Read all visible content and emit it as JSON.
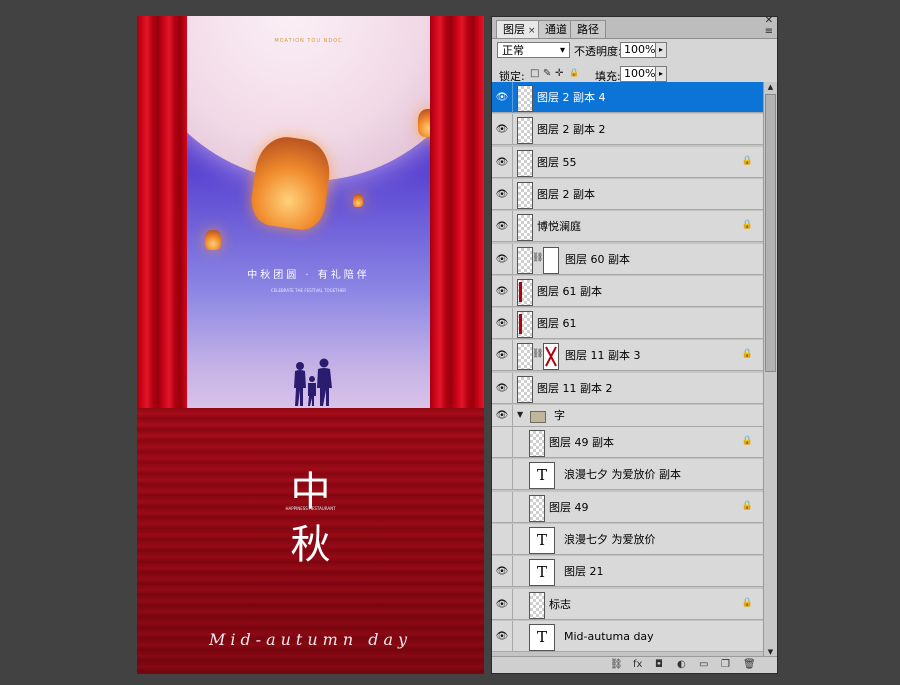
{
  "poster": {
    "brand_top": "MOATION TOU NDOC",
    "slogan": "中秋团圆 · 有礼陪伴",
    "subslogan": "CELEBRATE THE FESTIVAL TOGETHER",
    "char_one": "中",
    "char_two": "秋",
    "small_brand": "HAPPINESS RESTAURANT",
    "script": "Mid-autumn day"
  },
  "panel": {
    "tabs": [
      "图层",
      "通道",
      "路径"
    ],
    "tab_close": "×",
    "close_glyph": "✕",
    "menu_glyph": "≡",
    "blend_mode": "正常",
    "opacity_label": "不透明度:",
    "opacity_value": "100%",
    "lock_label": "锁定:",
    "fill_label": "填充:",
    "fill_value": "100%",
    "lock_icons": [
      "□",
      "✎",
      "✛",
      "🔒"
    ],
    "layers": [
      {
        "name": "图层 2 副本 4",
        "visible": true,
        "thumb": "checker",
        "locked": false,
        "selected": true
      },
      {
        "name": "图层 2 副本 2",
        "visible": true,
        "thumb": "checker",
        "locked": false
      },
      {
        "name": "图层 55",
        "visible": true,
        "thumb": "checker",
        "locked": true
      },
      {
        "name": "图层 2 副本",
        "visible": true,
        "thumb": "checker",
        "locked": false
      },
      {
        "name": "博悦澜庭",
        "visible": true,
        "thumb": "checker",
        "locked": true
      },
      {
        "name": "图层 60 副本",
        "visible": true,
        "thumb": "checker-mask",
        "locked": false
      },
      {
        "name": "图层 61 副本",
        "visible": true,
        "thumb": "red",
        "locked": false
      },
      {
        "name": "图层 61",
        "visible": true,
        "thumb": "red",
        "locked": false
      },
      {
        "name": "图层 11 副本 3",
        "visible": true,
        "thumb": "checker-mask-x",
        "locked": true
      },
      {
        "name": "图层 11 副本 2",
        "visible": true,
        "thumb": "checker",
        "locked": false
      },
      {
        "name": "字",
        "visible": true,
        "thumb": "group",
        "locked": false
      },
      {
        "name": "图层 49 副本",
        "visible": false,
        "thumb": "checker",
        "locked": true
      },
      {
        "name": "浪漫七夕 为爱放价 副本",
        "visible": false,
        "thumb": "type",
        "locked": false
      },
      {
        "name": "图层 49",
        "visible": false,
        "thumb": "checker",
        "locked": true
      },
      {
        "name": "浪漫七夕 为爱放价",
        "visible": false,
        "thumb": "type",
        "locked": false
      },
      {
        "name": "图层 21",
        "visible": true,
        "thumb": "type",
        "locked": false
      },
      {
        "name": "标志",
        "visible": true,
        "thumb": "checker",
        "locked": true
      },
      {
        "name": "Mid-autuma day",
        "visible": true,
        "thumb": "type",
        "locked": false
      }
    ],
    "eye_glyph": "👁",
    "lock_glyph": "🔒",
    "type_glyph": "T",
    "chain_glyph": "⛓",
    "group_arrow": "▼",
    "bottom_icons": [
      "link-layers-icon",
      "fx-icon",
      "mask-icon",
      "adjustment-icon",
      "group-icon",
      "new-layer-icon",
      "delete-icon"
    ],
    "bottom_glyphs": [
      "⛓",
      "fx",
      "◘",
      "◐",
      "▭",
      "❐",
      "🗑"
    ]
  }
}
